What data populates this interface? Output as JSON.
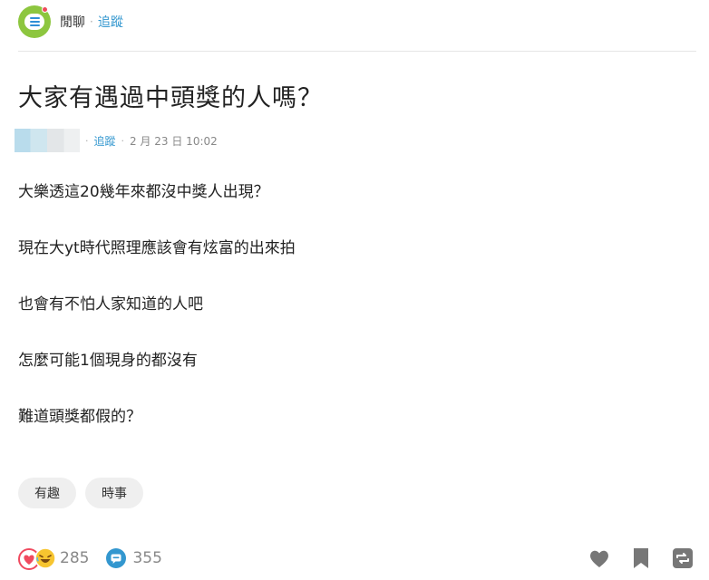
{
  "forum": {
    "name": "閒聊",
    "separator": "·",
    "follow_label": "追蹤",
    "logo_icon": "chat-bubble-icon",
    "logo_color": "#8dc63f"
  },
  "post": {
    "title": "大家有遇過中頭獎的人嗎？",
    "author": {
      "follow_label": "追蹤",
      "separator": "·",
      "date": "2 月 23 日 10:02"
    },
    "paragraphs": [
      "大樂透這20幾年來都沒中獎人出現？",
      "現在大yt時代照理應該會有炫富的出來拍",
      "也會有不怕人家知道的人吧",
      "怎麼可能1個現身的都沒有",
      "難道頭獎都假的？"
    ],
    "tags": [
      "有趣",
      "時事"
    ]
  },
  "footer": {
    "reaction_count": "285",
    "comment_count": "355",
    "reaction_icons": [
      "heart-reaction-icon",
      "laugh-reaction-icon"
    ],
    "comment_icon": "comment-bubble-icon",
    "actions": [
      "like-icon",
      "bookmark-icon",
      "share-icon"
    ]
  },
  "colors": {
    "link": "#3397cf",
    "count_text": "#888888",
    "tag_bg": "#efefef",
    "action_icon": "#777777"
  }
}
